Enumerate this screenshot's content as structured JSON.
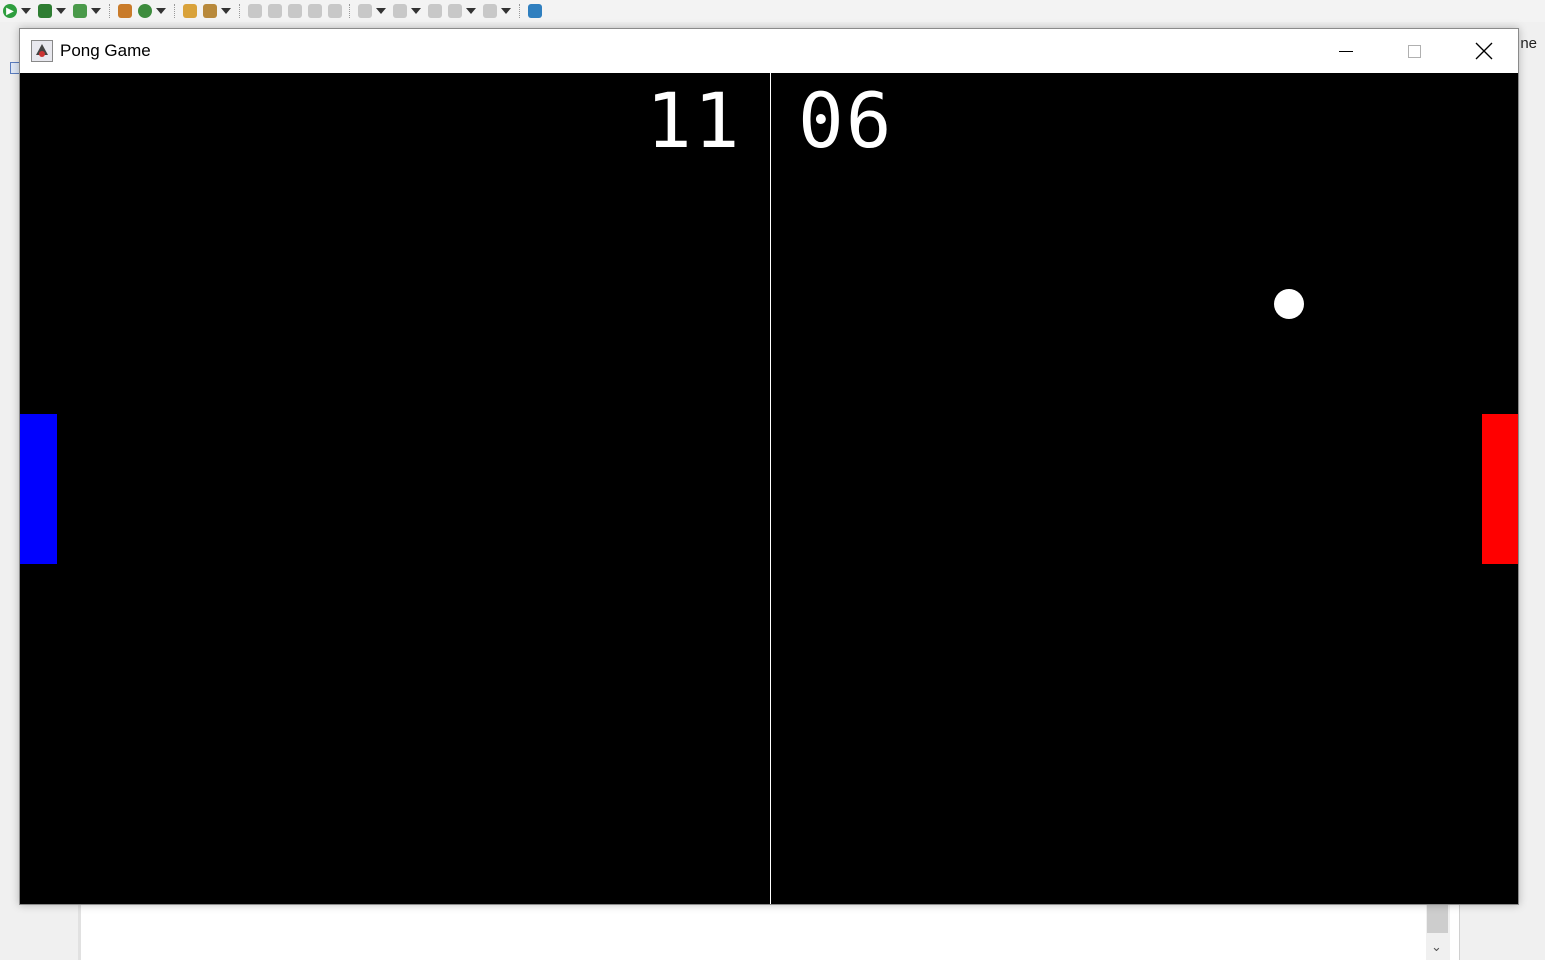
{
  "ide": {
    "right_text": "ne",
    "toolbar_icons": [
      "run-icon",
      "debug-icon",
      "coverage-icon",
      "new-package-icon",
      "refresh-icon",
      "open-folder-icon",
      "search-icon",
      "annotation-icon",
      "edit-icon",
      "paragraph-icon",
      "next-annotation-icon",
      "prev-annotation-icon",
      "back-icon",
      "forward-icon",
      "open-perspective-icon"
    ]
  },
  "window": {
    "title": "Pong Game",
    "icon": "java-app-icon",
    "controls": [
      "minimize-icon",
      "maximize-icon",
      "close-icon"
    ]
  },
  "game": {
    "score_left": "11",
    "score_right": "06",
    "colors": {
      "background": "#000000",
      "net": "#ffffff",
      "paddle_left": "#0000ff",
      "paddle_right": "#ff0000",
      "ball": "#ffffff",
      "text": "#ffffff"
    }
  }
}
